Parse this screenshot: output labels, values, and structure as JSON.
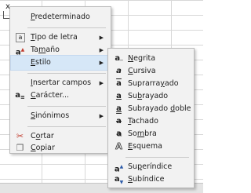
{
  "sheet": {
    "cell_letter": "x"
  },
  "context_menu": {
    "items": [
      {
        "before": "",
        "u": "P",
        "after": "redeterminado",
        "icon": "",
        "submenu": false
      },
      {
        "before": "",
        "u": "T",
        "after": "ipo de letra",
        "icon": "font-name-icon",
        "submenu": true
      },
      {
        "before": "Ta",
        "u": "m",
        "after": "año",
        "icon": "font-size-icon",
        "submenu": true
      },
      {
        "before": "",
        "u": "E",
        "after": "stilo",
        "icon": "",
        "submenu": true,
        "highlighted": true
      },
      {
        "before": "",
        "u": "I",
        "after": "nsertar campos",
        "icon": "",
        "submenu": true
      },
      {
        "before": "",
        "u": "C",
        "after": "arácter...",
        "icon": "character-icon",
        "submenu": false
      },
      {
        "before": "",
        "u": "S",
        "after": "inónimos",
        "icon": "",
        "submenu": true
      },
      {
        "before": "C",
        "u": "o",
        "after": "rtar",
        "icon": "cut-icon",
        "submenu": false
      },
      {
        "before": "",
        "u": "C",
        "after": "opiar",
        "icon": "copy-icon",
        "submenu": false
      }
    ]
  },
  "style_submenu": {
    "items": [
      {
        "before": "",
        "u": "N",
        "after": "egrita",
        "icon": "bold-icon",
        "glyph": "a"
      },
      {
        "before": "",
        "u": "C",
        "after": "ursiva",
        "icon": "italic-icon",
        "glyph": "a"
      },
      {
        "before": "Suprarra",
        "u": "y",
        "after": "ado",
        "icon": "overline-icon",
        "glyph": "a"
      },
      {
        "before": "Su",
        "u": "b",
        "after": "rayado",
        "icon": "underline-icon",
        "glyph": "a"
      },
      {
        "before": "Subrayado ",
        "u": "d",
        "after": "oble",
        "icon": "double-underline-icon",
        "glyph": "a"
      },
      {
        "before": "",
        "u": "T",
        "after": "achado",
        "icon": "strikethrough-icon",
        "glyph": "a"
      },
      {
        "before": "So",
        "u": "m",
        "after": "bra",
        "icon": "shadow-icon",
        "glyph": "a"
      },
      {
        "before": "",
        "u": "E",
        "after": "squema",
        "icon": "outline-icon",
        "glyph": "A"
      },
      {
        "before": "Su",
        "u": "p",
        "after": "eríndice",
        "icon": "superscript-icon",
        "glyph": "a"
      },
      {
        "before": "",
        "u": "S",
        "after": "ubíndice",
        "icon": "subscript-icon",
        "glyph": "a"
      }
    ]
  },
  "colors": {
    "highlight": "#d6e7f7",
    "menu_bg": "#f2f2f2",
    "cut_icon": "#c0392b",
    "accent_icon": "#2b5aa8"
  }
}
